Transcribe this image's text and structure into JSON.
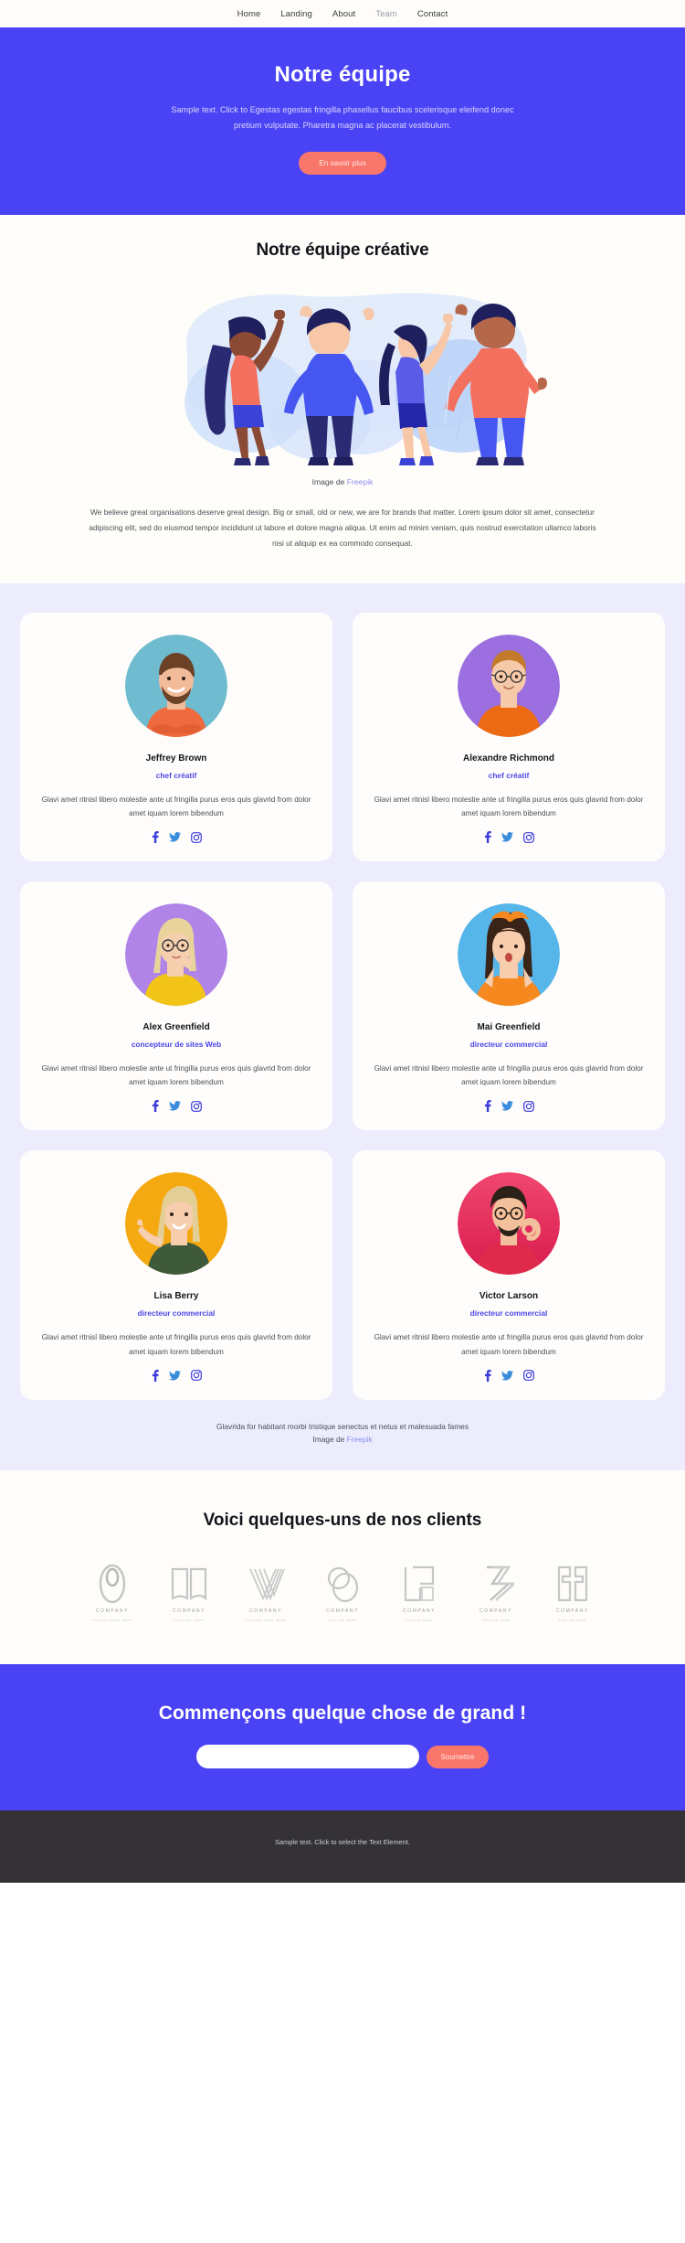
{
  "nav": {
    "items": [
      {
        "label": "Home",
        "active": false
      },
      {
        "label": "Landing",
        "active": false
      },
      {
        "label": "About",
        "active": false
      },
      {
        "label": "Team",
        "active": true
      },
      {
        "label": "Contact",
        "active": false
      }
    ]
  },
  "hero": {
    "title": "Notre équipe",
    "subtitle": "Sample text. Click to Egestas egestas fringilla phasellus faucibus scelerisque eleifend donec pretium vulputate. Pharetra magna ac placerat vestibulum.",
    "cta_label": "En savoir plus",
    "bg_color": "#4a43f5",
    "button_color": "#f9766a"
  },
  "creative": {
    "title": "Notre équipe créative",
    "image_credit_prefix": "Image de ",
    "image_credit_link": "Freepik",
    "paragraph": "We believe great organisations deserve great design. Big or small, old or new, we are for brands that matter. Lorem ipsum dolor sit amet, consectetur adipiscing elit, sed do eiusmod tempor incididunt ut labore et dolore magna aliqua. Ut enim ad minim veniam, quis nostrud exercitation ullamco laboris nisi ut aliquip ex ea commodo consequat."
  },
  "team": {
    "accent_color": "#4a46e8",
    "section_bg": "#ececfd",
    "members": [
      {
        "name": "Jeffrey Brown",
        "role": "chef créatif",
        "description": "Glavi amet ritnisl libero molestie ante ut fringilla purus eros quis glavrid from dolor amet iquam lorem bibendum",
        "avatar_bg": "#6fbcd0",
        "shirt": "#ef6b3e",
        "skin": "#f2bb9a",
        "hair": "#6b4226",
        "socials": [
          "facebook-icon",
          "twitter-icon",
          "instagram-icon"
        ]
      },
      {
        "name": "Alexandre Richmond",
        "role": "chef créatif",
        "description": "Glavi amet ritnisl libero molestie ante ut fringilla purus eros quis glavrid from dolor amet iquam lorem bibendum",
        "avatar_bg": "#9b6fe0",
        "shirt": "#ec6a13",
        "skin": "#f6c9a8",
        "hair": "#c47a2b",
        "socials": [
          "facebook-icon",
          "twitter-icon",
          "instagram-icon"
        ]
      },
      {
        "name": "Alex Greenfield",
        "role": "concepteur de sites Web",
        "description": "Glavi amet ritnisl libero molestie ante ut fringilla purus eros quis glavrid from dolor amet iquam lorem bibendum",
        "avatar_bg": "#b184e8",
        "shirt": "#f2c417",
        "skin": "#f6cfae",
        "hair": "#e8d49a",
        "socials": [
          "facebook-icon",
          "twitter-icon",
          "instagram-icon"
        ]
      },
      {
        "name": "Mai Greenfield",
        "role": "directeur commercial",
        "description": "Glavi amet ritnisl libero molestie ante ut fringilla purus eros quis glavrid from dolor amet iquam lorem bibendum",
        "avatar_bg": "#56b6ea",
        "shirt": "#f5881e",
        "skin": "#f7cdae",
        "hair": "#3a2418",
        "socials": [
          "facebook-icon",
          "twitter-icon",
          "instagram-icon"
        ]
      },
      {
        "name": "Lisa Berry",
        "role": "directeur commercial",
        "description": "Glavi amet ritnisl libero molestie ante ut fringilla purus eros quis glavrid from dolor amet iquam lorem bibendum",
        "avatar_bg": "#f5a911",
        "shirt": "#3f5a3a",
        "skin": "#f6cdad",
        "hair": "#e3cf96",
        "socials": [
          "facebook-icon",
          "twitter-icon",
          "instagram-icon"
        ]
      },
      {
        "name": "Victor Larson",
        "role": "directeur commercial",
        "description": "Glavi amet ritnisl libero molestie ante ut fringilla purus eros quis glavrid from dolor amet iquam lorem bibendum",
        "avatar_bg": "#e8315f",
        "shirt": "#e02a4c",
        "skin": "#f3c09c",
        "hair": "#2c2118",
        "socials": [
          "facebook-icon",
          "twitter-icon",
          "instagram-icon"
        ]
      }
    ],
    "footer_line": "Glavrida for habitant morbi tristique senectus et netus et malesuada fames",
    "footer_credit_prefix": "Image de ",
    "footer_credit_link": "Freepik"
  },
  "clients": {
    "title": "Voici quelques-uns de nos clients",
    "logos": [
      {
        "name": "COMPANY",
        "tagline": "TAGLINE GOES HERE",
        "mark": "oval-ring-mark"
      },
      {
        "name": "COMPANY",
        "tagline": "TAG LINE HERE",
        "mark": "open-book-mark"
      },
      {
        "name": "COMPANY",
        "tagline": "TAGLINE GOES HERE",
        "mark": "chevron-lines-mark"
      },
      {
        "name": "COMPANY",
        "tagline": "TAGLINE HERE",
        "mark": "circle-overlap-mark"
      },
      {
        "name": "COMPANY",
        "tagline": "TAGLINE HERE",
        "mark": "square-bracket-mark"
      },
      {
        "name": "COMPANY",
        "tagline": "TAGLINE HERE",
        "mark": "diagonal-stripes-mark"
      },
      {
        "name": "COMPANY",
        "tagline": "TAGLINE HERE",
        "mark": "mirrored-blocks-mark"
      }
    ]
  },
  "cta": {
    "title": "Commençons quelque chose de grand !",
    "input_placeholder": "",
    "input_value": "",
    "submit_label": "Soumettre"
  },
  "footer": {
    "text": "Sample text. Click to select the Text Element."
  }
}
